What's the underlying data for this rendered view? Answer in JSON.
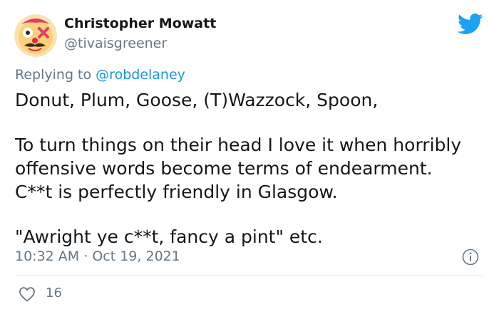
{
  "author": {
    "display_name": "Christopher Mowatt",
    "handle": "@tivaisgreener",
    "avatar_icon": "clown-face-avatar"
  },
  "brand": {
    "icon": "twitter-bird-icon",
    "color": "#1da1f2"
  },
  "reply": {
    "prefix": "Replying to",
    "mention": "@robdelaney"
  },
  "body": {
    "line1": "Donut, Plum, Goose, (T)Wazzock, Spoon,",
    "line2": "To turn things on their head I love it when horribly",
    "line3": "offensive words become terms of endearment.",
    "line4": "C**t is perfectly friendly in Glasgow.",
    "line5": "\"Awright ye c**t, fancy a pint\" etc."
  },
  "meta": {
    "time": "10:32 AM",
    "separator": "·",
    "date": "Oct 19, 2021"
  },
  "actions": {
    "like_count": "16"
  },
  "colors": {
    "text": "#14171a",
    "secondary": "#657786",
    "link": "#1b95e0",
    "divider": "#e1e8ed"
  }
}
